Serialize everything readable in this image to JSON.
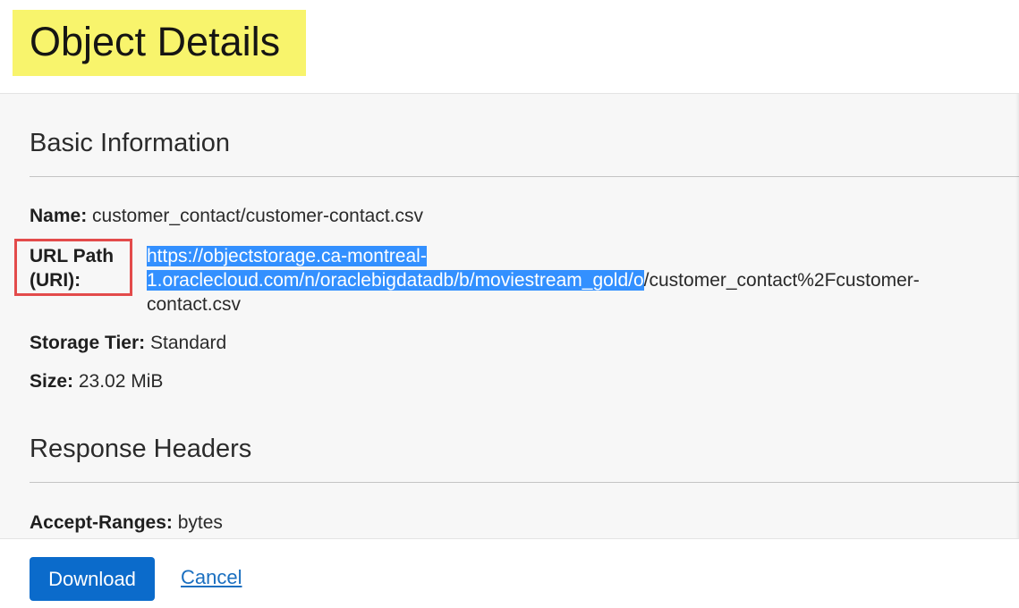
{
  "header": {
    "title": "Object Details"
  },
  "basic_info": {
    "heading": "Basic Information",
    "name_label": "Name:",
    "name_value": "customer_contact/customer-contact.csv",
    "url_label_line1": "URL Path",
    "url_label_line2": "(URI):",
    "url_selected_line1": "https://objectstorage.ca-montreal-",
    "url_selected_line2": "1.oraclecloud.com/n/oraclebigdatadb/b/moviestream_gold/o",
    "url_rest_line2": "/customer_contact%2Fcustomer-",
    "url_line3": "contact.csv",
    "storage_tier_label": "Storage Tier:",
    "storage_tier_value": "Standard",
    "size_label": "Size:",
    "size_value": "23.02 MiB"
  },
  "response_headers": {
    "heading": "Response Headers",
    "accept_ranges_label": "Accept-Ranges:",
    "accept_ranges_value": "bytes"
  },
  "footer": {
    "download_label": "Download",
    "cancel_label": "Cancel"
  },
  "colors": {
    "title_highlight": "#f8f46c",
    "selection": "#3390ff",
    "annotation_box": "#e34b4b",
    "primary_button": "#0b6bcb"
  }
}
